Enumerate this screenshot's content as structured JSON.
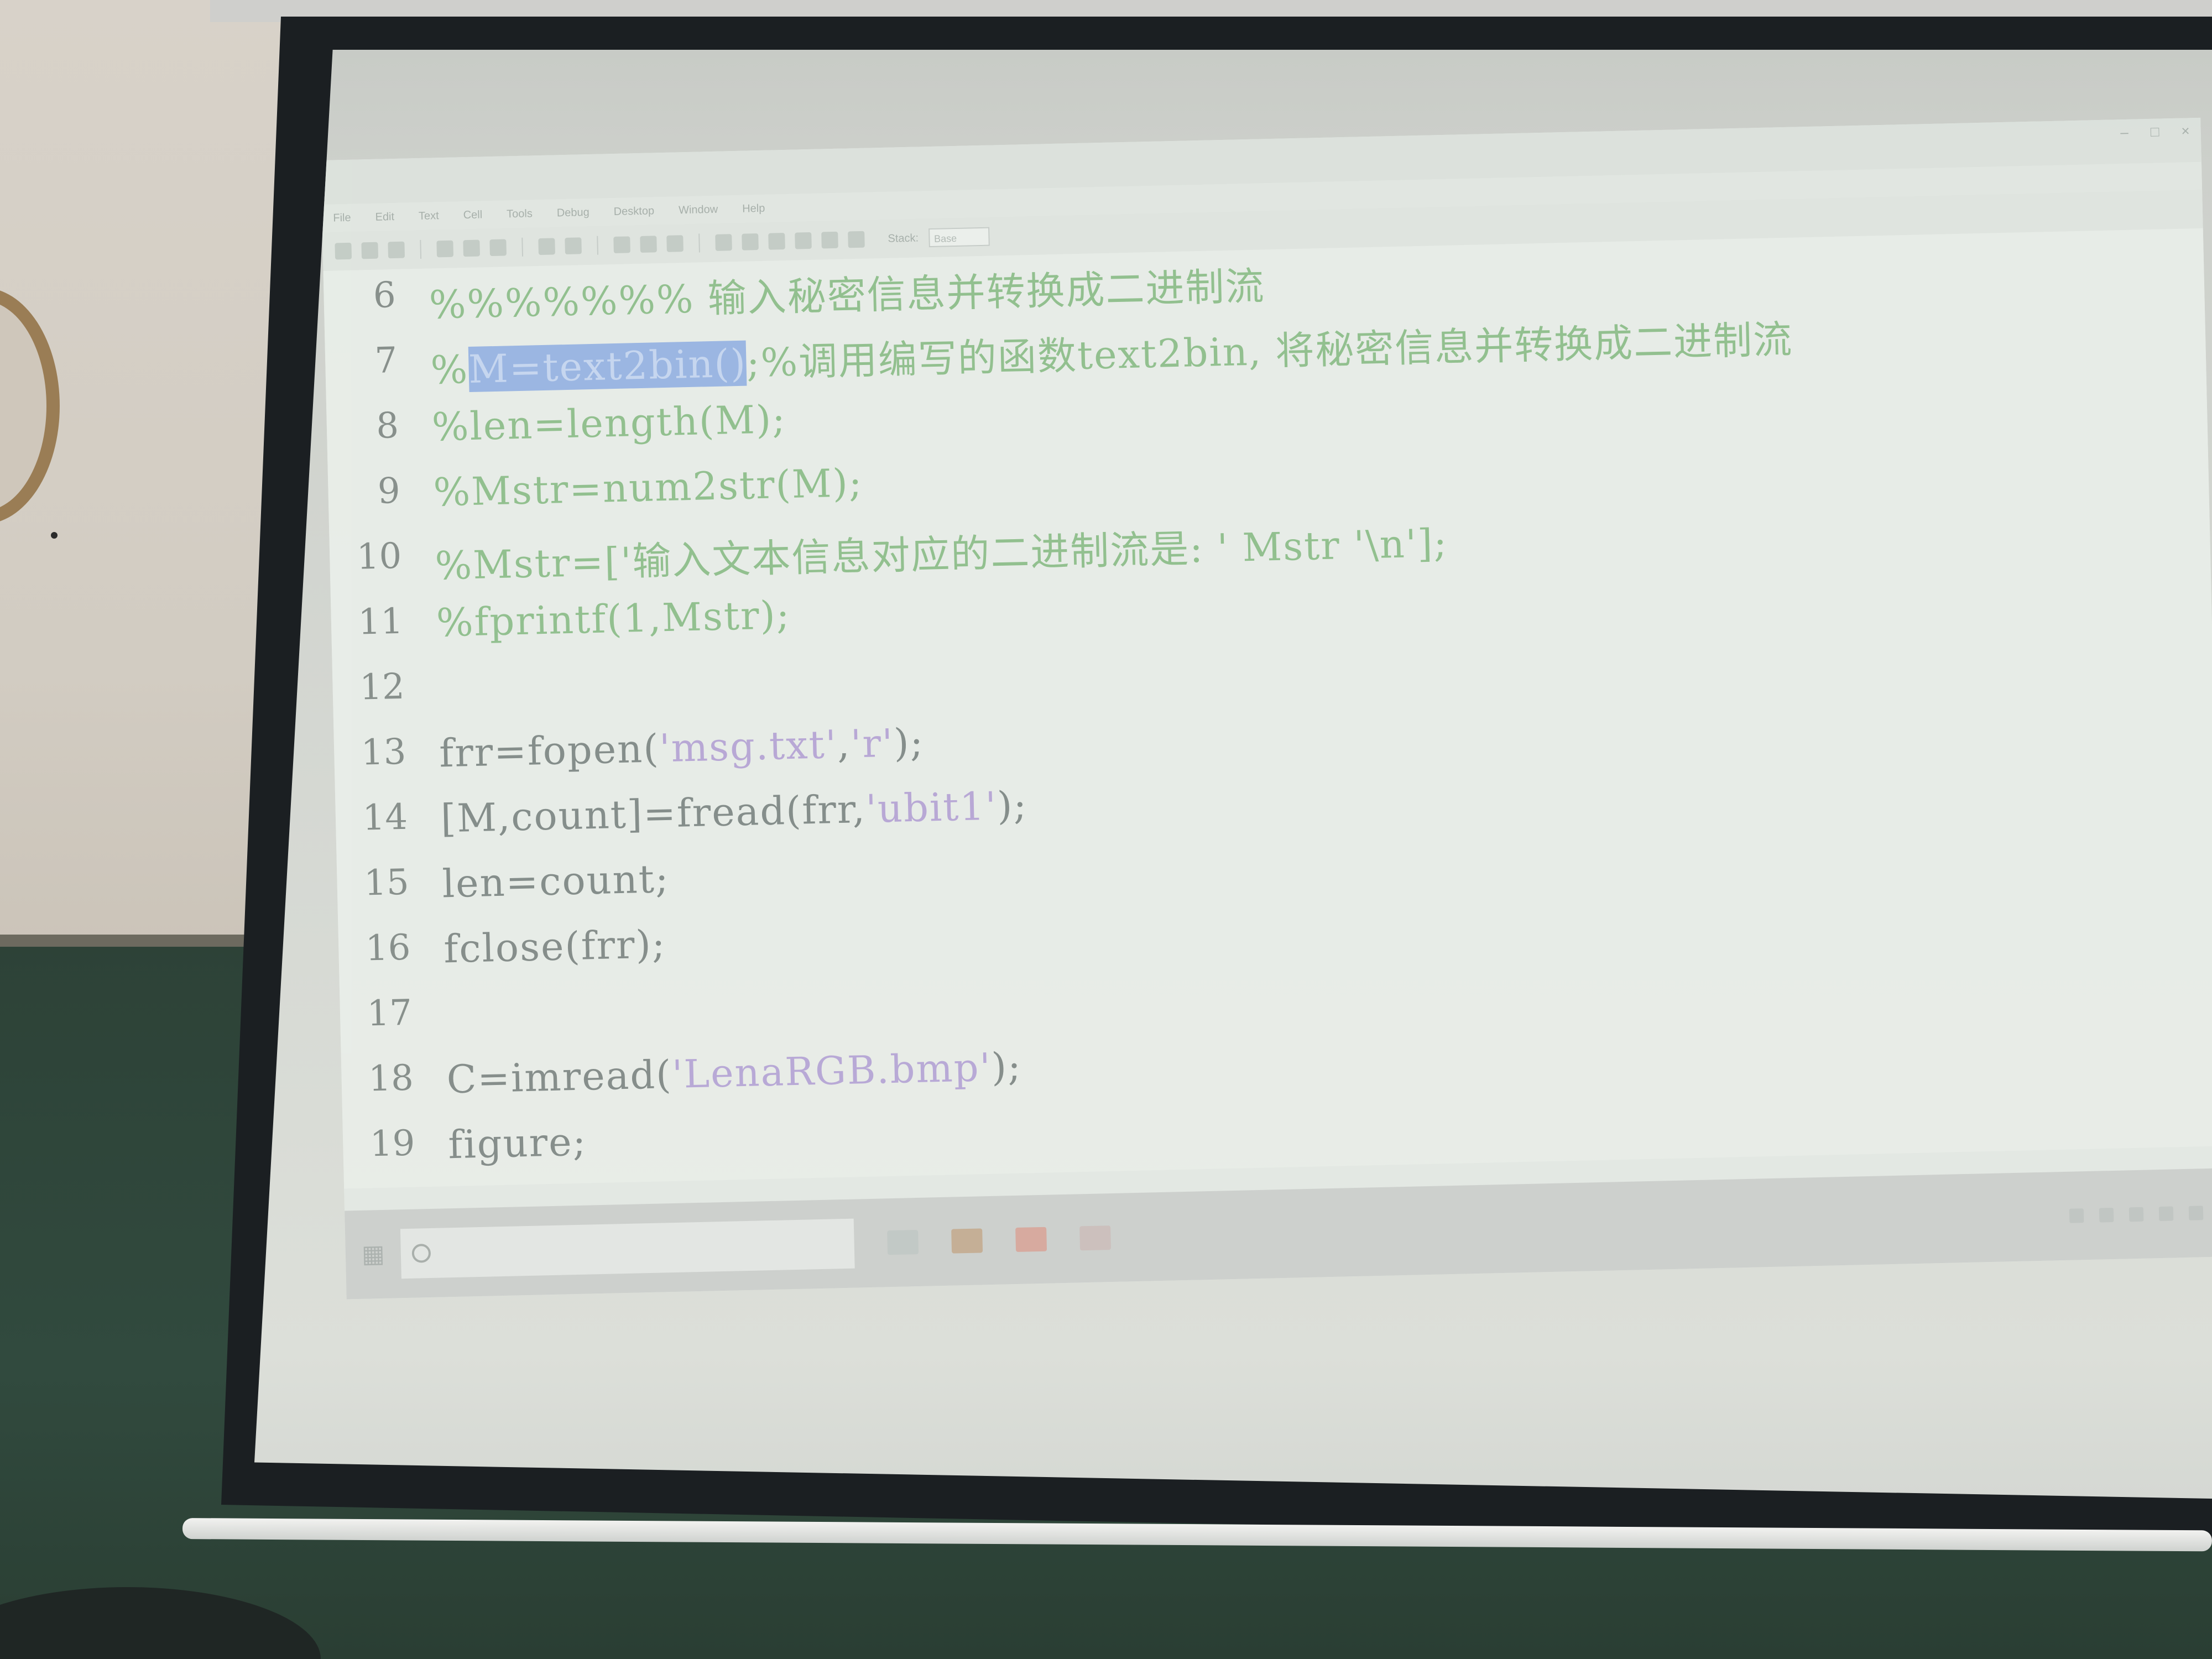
{
  "window": {
    "title": "",
    "menu": [
      "File",
      "Edit",
      "Text",
      "Cell",
      "Tools",
      "Debug",
      "Desktop",
      "Window",
      "Help"
    ],
    "stack_label": "Stack:",
    "stack_value": "Base"
  },
  "editor": {
    "selected_text": "M=text2bin()",
    "lines": [
      {
        "n": "6",
        "segments": [
          {
            "t": "%%%%%%% 输入秘密信息并转换成二进制流",
            "k": "comment"
          }
        ]
      },
      {
        "n": "7",
        "segments": [
          {
            "t": "%",
            "k": "comment"
          },
          {
            "t": "M=text2bin()",
            "k": "sel"
          },
          {
            "t": ";%调用编写的函数text2bin, 将秘密信息并转换成二进制流",
            "k": "comment"
          }
        ]
      },
      {
        "n": "8",
        "segments": [
          {
            "t": "%len=length(M);",
            "k": "comment"
          }
        ]
      },
      {
        "n": "9",
        "segments": [
          {
            "t": "%Mstr=num2str(M);",
            "k": "comment"
          }
        ]
      },
      {
        "n": "10",
        "segments": [
          {
            "t": "%Mstr=['输入文本信息对应的二进制流是: ' Mstr '\\n'];",
            "k": "comment"
          }
        ]
      },
      {
        "n": "11",
        "segments": [
          {
            "t": "%fprintf(1,Mstr);",
            "k": "comment"
          }
        ]
      },
      {
        "n": "12",
        "segments": []
      },
      {
        "n": "13",
        "segments": [
          {
            "t": "frr=fopen(",
            "k": "normal"
          },
          {
            "t": "'msg.txt'",
            "k": "string"
          },
          {
            "t": ",",
            "k": "normal"
          },
          {
            "t": "'r'",
            "k": "string"
          },
          {
            "t": ");",
            "k": "normal"
          }
        ]
      },
      {
        "n": "14",
        "segments": [
          {
            "t": "[M,count]=fread(frr,",
            "k": "normal"
          },
          {
            "t": "'ubit1'",
            "k": "string"
          },
          {
            "t": ");",
            "k": "normal"
          }
        ]
      },
      {
        "n": "15",
        "segments": [
          {
            "t": "len=count;",
            "k": "normal"
          }
        ]
      },
      {
        "n": "16",
        "segments": [
          {
            "t": "fclose(frr);",
            "k": "normal"
          }
        ]
      },
      {
        "n": "17",
        "segments": []
      },
      {
        "n": "18",
        "segments": [
          {
            "t": "C=imread(",
            "k": "normal"
          },
          {
            "t": "'LenaRGB.bmp'",
            "k": "string"
          },
          {
            "t": ");",
            "k": "normal"
          }
        ]
      },
      {
        "n": "19",
        "segments": [
          {
            "t": "figure;",
            "k": "normal"
          }
        ]
      }
    ]
  },
  "taskbar": {
    "search_placeholder": ""
  },
  "colors": {
    "comment": "#8fbf8c",
    "string": "#b7a6d6",
    "normal": "#818a87",
    "selection": "#98b5e4",
    "line_number": "#848c88"
  }
}
